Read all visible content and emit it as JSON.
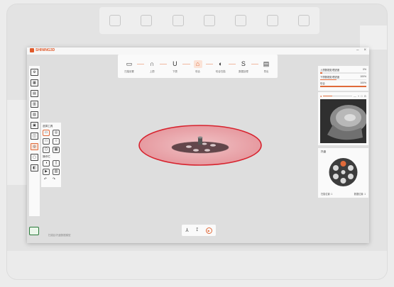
{
  "app": {
    "logo_text": "SHINING3D",
    "win_controls": [
      "–",
      "×"
    ]
  },
  "toolbar": {
    "steps": [
      {
        "label": "扫描设置",
        "icon": "▭"
      },
      {
        "label": "上颌",
        "icon": "∩"
      },
      {
        "label": "下颌",
        "icon": "U"
      },
      {
        "label": "咬合",
        "icon": "⌂",
        "active": true
      },
      {
        "label": "咬合扫描",
        "icon": "◐"
      },
      {
        "label": "数据处理",
        "icon": "S"
      },
      {
        "label": "导出",
        "icon": "▤"
      }
    ]
  },
  "select_panel": {
    "title": "选择工具",
    "section2": "操作栏"
  },
  "right_panel": {
    "rows": [
      {
        "label": "上颌数据处理进度",
        "value": "0%",
        "progress": 0.05
      },
      {
        "label": "下颌数据处理进度",
        "value": "100%",
        "progress": 0.35
      },
      {
        "label": "咬合",
        "value": "100%",
        "progress": 1.0
      }
    ],
    "preview_controls": [
      "●",
      "—",
      "+",
      "□",
      "⊙"
    ],
    "preview_slider": 0.3,
    "cards_title": "托盘",
    "cards_footer_left": "扫描位置: 1",
    "cards_footer_right": "数据位置: 1"
  },
  "status": {
    "text": "扫描区/托盘数据模型"
  },
  "colors": {
    "accent": "#e06a3a",
    "disc_fill": "#e9a4a8",
    "disc_stroke": "#d7232e"
  }
}
